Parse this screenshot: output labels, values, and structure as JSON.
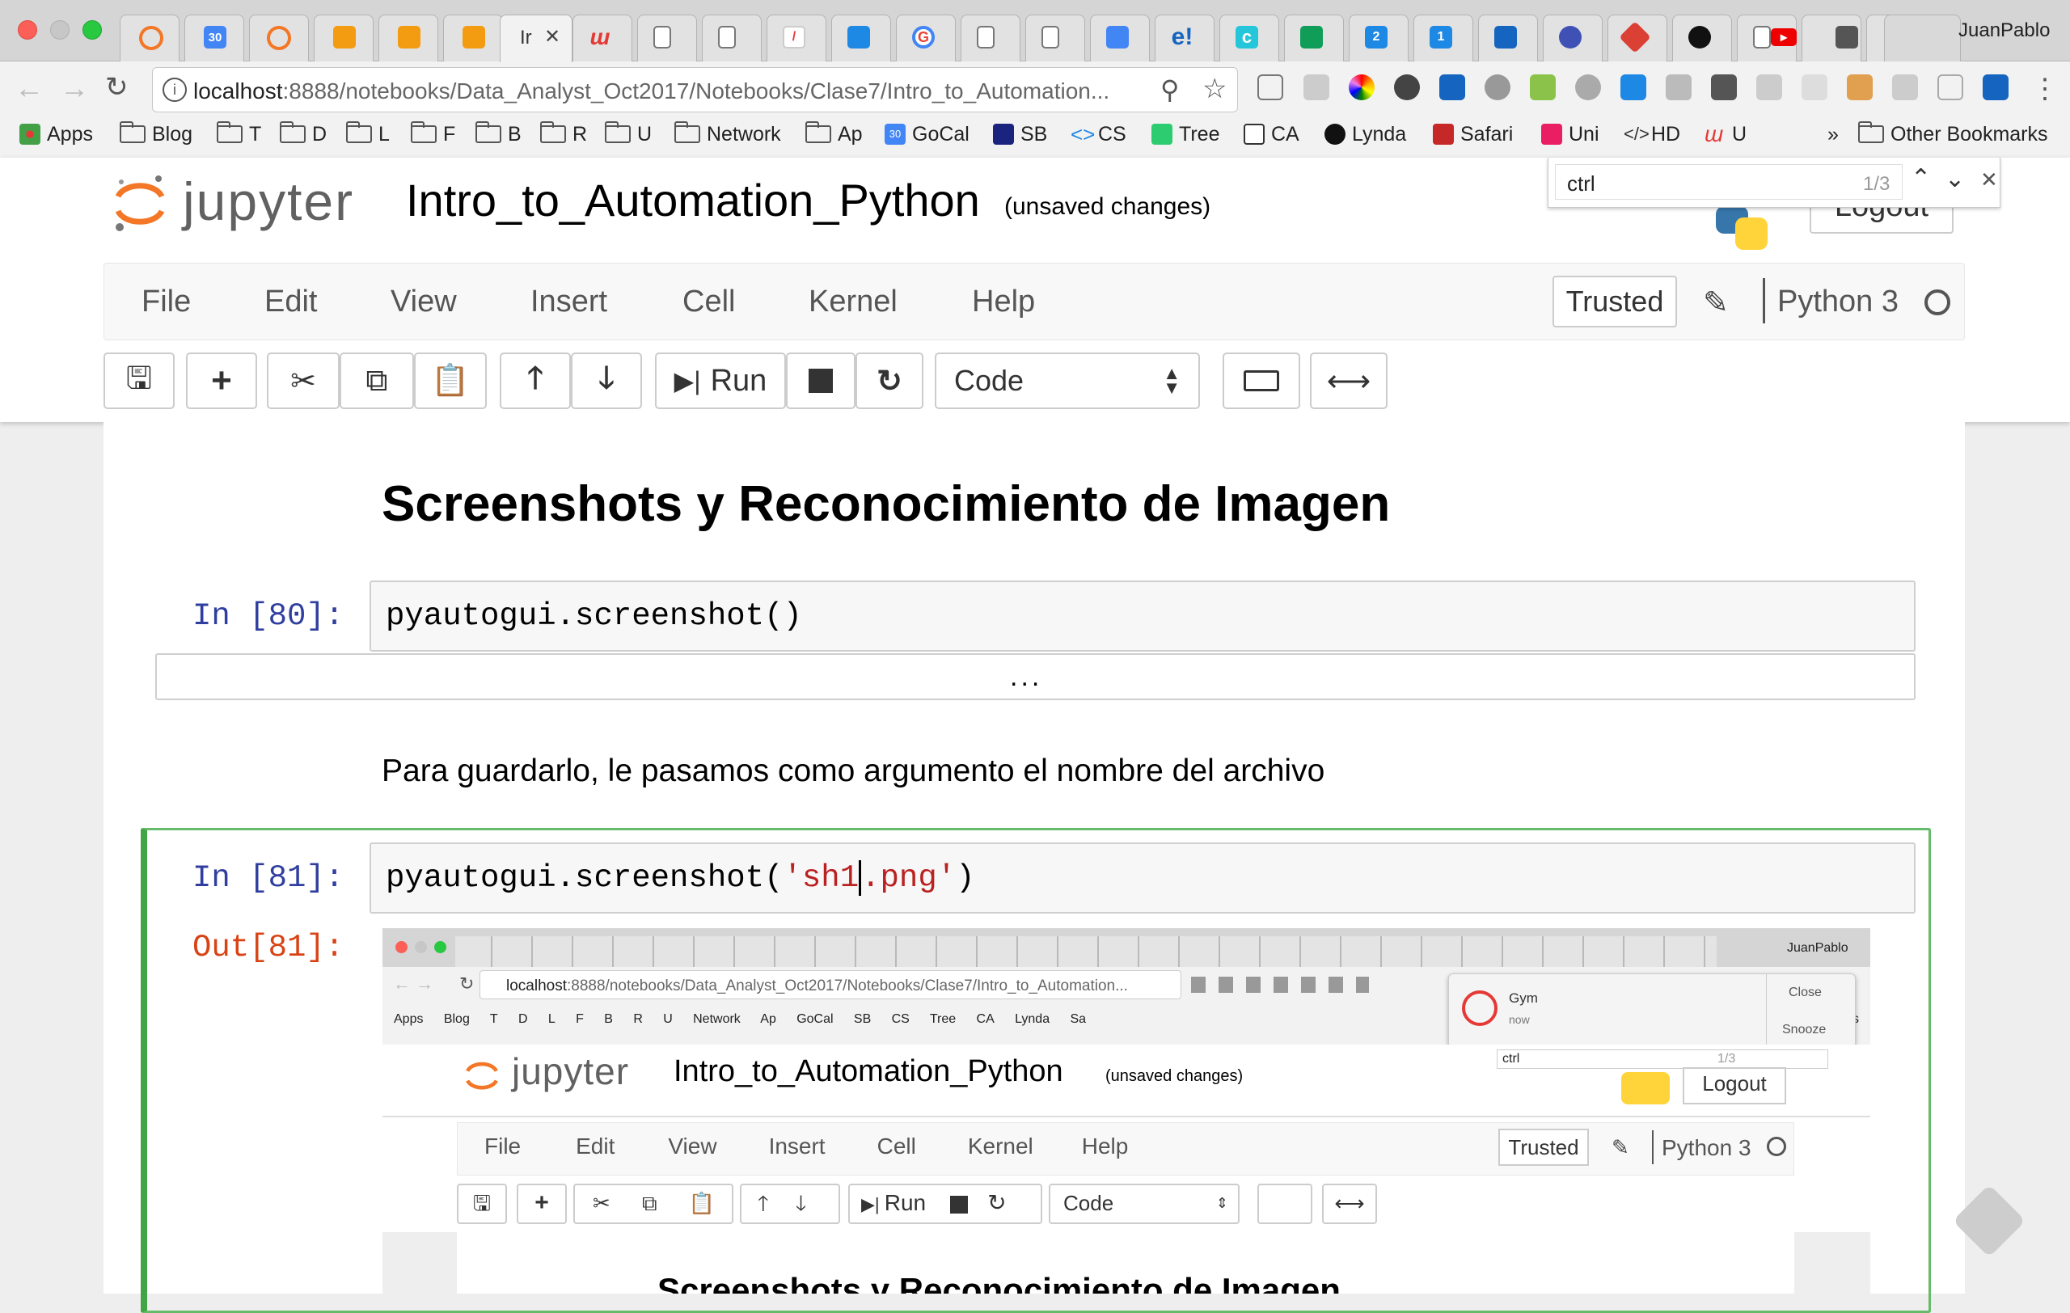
{
  "browser": {
    "profile_name": "JuanPablo",
    "active_tab_label": "Ir",
    "url_host": "localhost",
    "url_path": ":8888/notebooks/Data_Analyst_Oct2017/Notebooks/Clase7/Intro_to_Automation...",
    "find": {
      "query": "ctrl",
      "count": "1/3"
    },
    "bookmarks": [
      {
        "label": "Apps",
        "kind": "apps"
      },
      {
        "label": "Blog",
        "kind": "folder"
      },
      {
        "label": "T",
        "kind": "folder"
      },
      {
        "label": "D",
        "kind": "folder"
      },
      {
        "label": "L",
        "kind": "folder"
      },
      {
        "label": "F",
        "kind": "folder"
      },
      {
        "label": "B",
        "kind": "folder"
      },
      {
        "label": "R",
        "kind": "folder"
      },
      {
        "label": "U",
        "kind": "folder"
      },
      {
        "label": "Network",
        "kind": "folder"
      },
      {
        "label": "Ap",
        "kind": "folder"
      },
      {
        "label": "GoCal",
        "kind": "calendar",
        "badge": "30"
      },
      {
        "label": "SB",
        "kind": "site"
      },
      {
        "label": "CS",
        "kind": "code"
      },
      {
        "label": "Tree",
        "kind": "site"
      },
      {
        "label": "CA",
        "kind": "site"
      },
      {
        "label": "Lynda",
        "kind": "site"
      },
      {
        "label": "Safari",
        "kind": "site"
      },
      {
        "label": "Uni",
        "kind": "site"
      },
      {
        "label": "HD",
        "kind": "site"
      },
      {
        "label": "U",
        "kind": "site"
      }
    ],
    "overflow": "»",
    "other_bookmarks": "Other Bookmarks",
    "tab_icon_texts": {
      "calendar": "30",
      "evernote": "e!",
      "c": "c",
      "cal2": "2",
      "cal1": "1"
    }
  },
  "jupyter": {
    "logo_text": "jupyter",
    "notebook_title": "Intro_to_Automation_Python",
    "save_status": "(unsaved changes)",
    "logout_label": "Logout",
    "menu": [
      "File",
      "Edit",
      "View",
      "Insert",
      "Cell",
      "Kernel",
      "Help"
    ],
    "trusted_label": "Trusted",
    "kernel_name": "Python 3",
    "toolbar": {
      "run_label": "Run",
      "cell_type": "Code"
    }
  },
  "cells": {
    "heading": "Screenshots y Reconocimiento de Imagen",
    "cell1": {
      "prompt": "In [80]:",
      "code": "pyautogui.screenshot()",
      "collapsed_output": "..."
    },
    "markdown": "Para guardarlo, le pasamos como argumento el nombre del archivo",
    "cell2": {
      "prompt": "In [81]:",
      "code_prefix": "pyautogui.screenshot(",
      "code_string_a": "'sh1",
      "code_string_b": ".png'",
      "code_suffix": ")",
      "out_prompt": "Out[81]:"
    }
  },
  "output_screenshot": {
    "profile_name": "JuanPablo",
    "url_host": "localhost",
    "url_path": ":8888/notebooks/Data_Analyst_Oct2017/Notebooks/Clase7/Intro_to_Automation...",
    "bookmarks": [
      "Apps",
      "Blog",
      "T",
      "D",
      "L",
      "F",
      "B",
      "R",
      "U",
      "Network",
      "Ap",
      "GoCal",
      "SB",
      "CS",
      "Tree",
      "CA",
      "Lynda",
      "Sa"
    ],
    "bookmarks_tail": "ks",
    "notification": {
      "title": "Gym",
      "time": "now",
      "close": "Close",
      "snooze": "Snooze"
    },
    "find": {
      "query": "ctrl",
      "count": "1/3"
    },
    "logo_text": "jupyter",
    "notebook_title": "Intro_to_Automation_Python",
    "save_status": "(unsaved changes)",
    "logout_label": "Logout",
    "menu": [
      "File",
      "Edit",
      "View",
      "Insert",
      "Cell",
      "Kernel",
      "Help"
    ],
    "trusted_label": "Trusted",
    "kernel_name": "Python 3",
    "run_label": "Run",
    "cell_type": "Code",
    "heading": "Screenshots y Reconocimiento de Imagen"
  },
  "colors": {
    "jupyter_orange": "#f37726",
    "selected_cell_border": "#66bb6a",
    "in_prompt": "#303f9f",
    "out_prompt": "#d84315",
    "string": "#ba2121"
  }
}
